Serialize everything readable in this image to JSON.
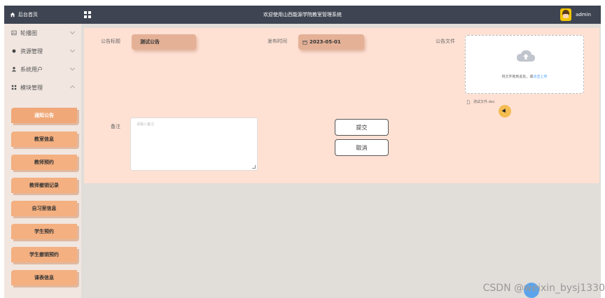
{
  "header": {
    "home_label": "后台首页",
    "title": "欢迎使用山西能源学院教室管理系统",
    "username": "admin"
  },
  "sidebar": {
    "menu": [
      {
        "label": "轮播图",
        "icon": "image-icon"
      },
      {
        "label": "资源管理",
        "icon": "dot-icon"
      },
      {
        "label": "系统用户",
        "icon": "user-icon"
      },
      {
        "label": "模块管理",
        "icon": "module-icon"
      }
    ],
    "submenu": [
      "通知公告",
      "教室信息",
      "教师预约",
      "教师撤销记录",
      "自习室信息",
      "学生预约",
      "学生撤销预约",
      "课表信息"
    ]
  },
  "form": {
    "title_label": "公告标题",
    "title_value": "测试公告",
    "date_label": "发布时间",
    "date_value": "2023-05-01",
    "file_label": "公告文件",
    "upload_text": "将文件拖到此处，或",
    "upload_link": "点击上传",
    "file_name": "测试文件.doc",
    "remark_label": "备注",
    "remark_placeholder": "请输入备注",
    "submit_label": "提交",
    "cancel_label": "取消"
  },
  "watermark": "CSDN @weixin_bysj1330"
}
